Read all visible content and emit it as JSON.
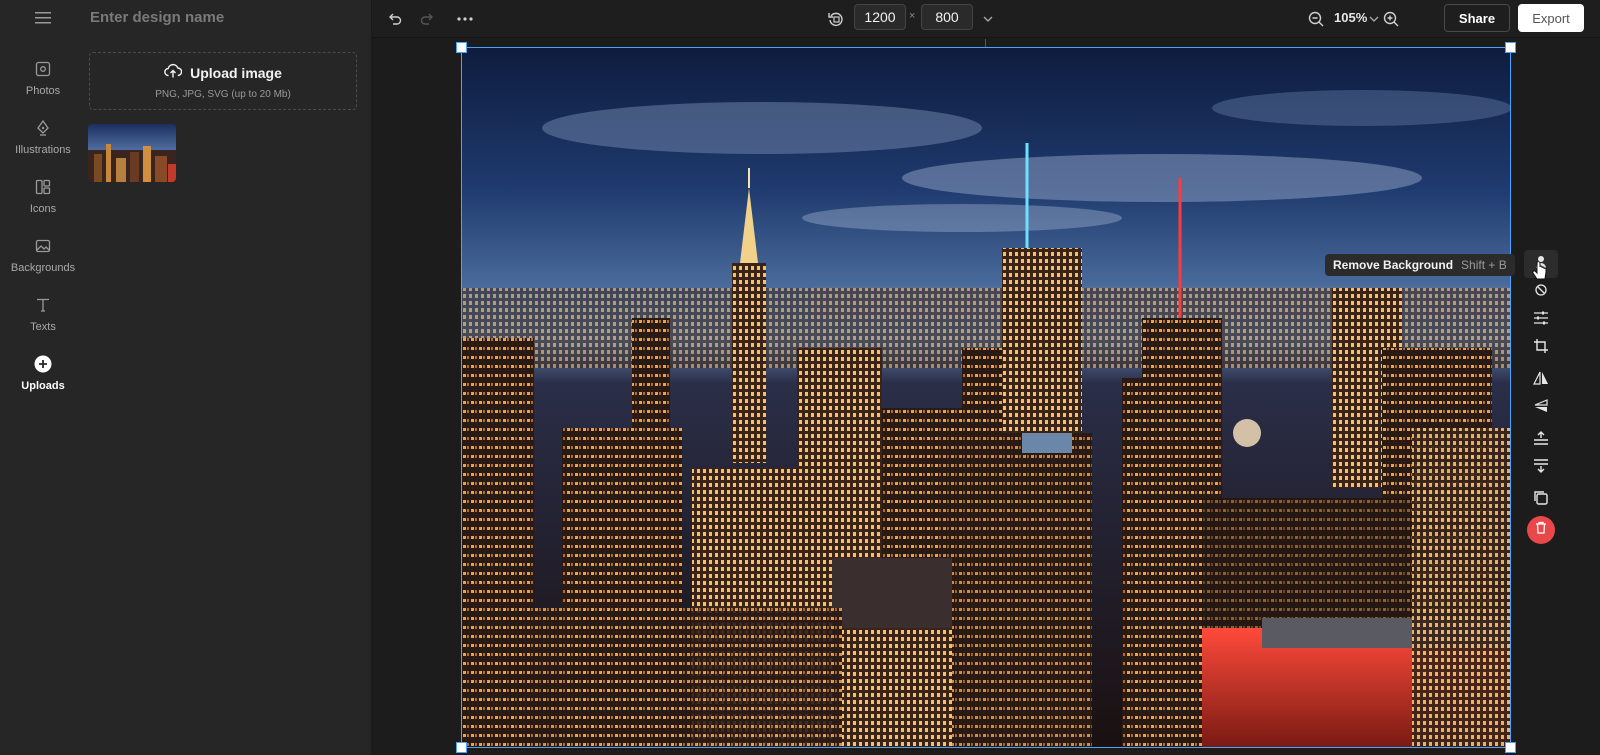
{
  "app": {
    "design_name_placeholder": "Enter design name"
  },
  "rail": {
    "items": [
      {
        "label": "Photos",
        "icon": "photo-icon"
      },
      {
        "label": "Illustrations",
        "icon": "pen-nib-icon"
      },
      {
        "label": "Icons",
        "icon": "shapes-icon"
      },
      {
        "label": "Backgrounds",
        "icon": "image-icon"
      },
      {
        "label": "Texts",
        "icon": "text-icon"
      },
      {
        "label": "Uploads",
        "icon": "plus-circle-icon",
        "active": true
      }
    ]
  },
  "upload": {
    "title": "Upload image",
    "subtitle": "PNG, JPG, SVG (up to 20 Mb)"
  },
  "topbar": {
    "width": "1200",
    "height": "800",
    "times": "×",
    "zoom": "105%",
    "share_label": "Share",
    "export_label": "Export"
  },
  "tooltip": {
    "label": "Remove Background",
    "shortcut": "Shift + B"
  },
  "colors": {
    "accent": "#4aa3ff",
    "danger": "#e8484a",
    "panel_bg": "#262626",
    "canvas_bg": "#1c1c1c"
  }
}
